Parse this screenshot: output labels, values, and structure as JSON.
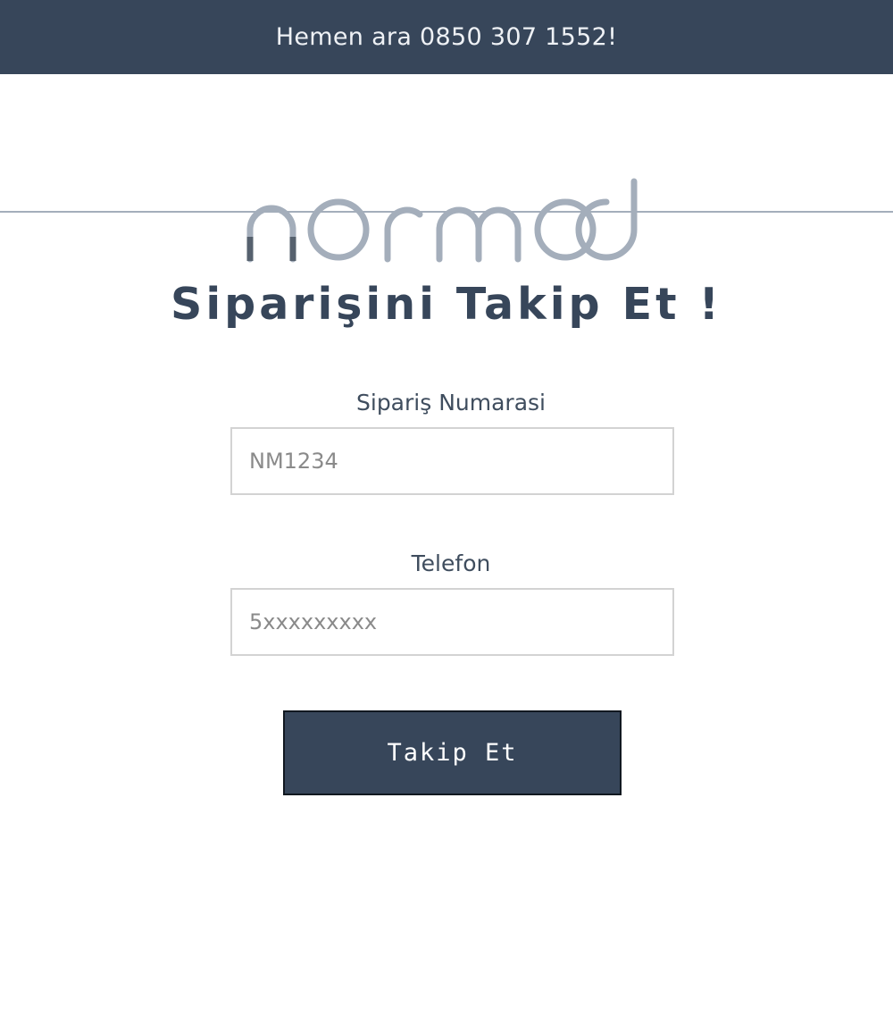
{
  "topbar": {
    "text": "Hemen ara 0850 307 1552!"
  },
  "logo": {
    "text": "normod",
    "color": "#a4aebb",
    "accent_color": "#56616e"
  },
  "form": {
    "title": "Siparişini Takip Et !",
    "order_label": "Sipariş Numarasi",
    "order_placeholder": "NM1234",
    "order_value": "",
    "phone_label": "Telefon",
    "phone_placeholder": "5xxxxxxxxx",
    "phone_value": "",
    "submit_label": "Takip Et"
  },
  "colors": {
    "primary": "#37465a",
    "divider": "#a4aebb",
    "input_border": "#d3d3d3"
  }
}
